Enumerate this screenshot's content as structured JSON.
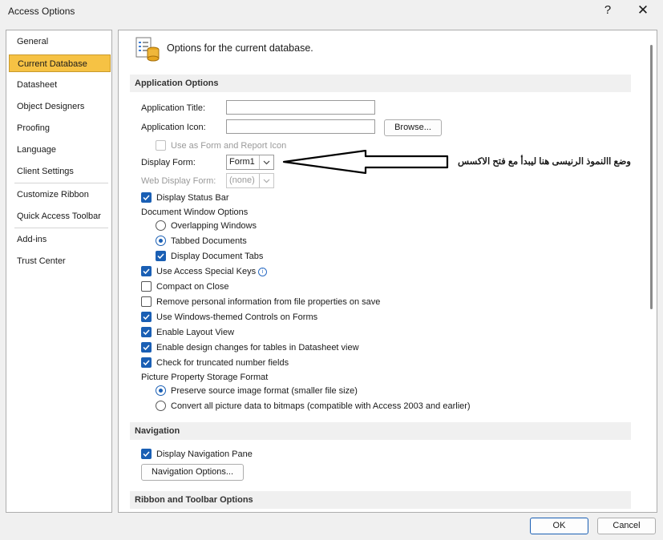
{
  "window": {
    "title": "Access Options",
    "help_glyph": "?",
    "close_glyph": "✕"
  },
  "sidebar": {
    "items": [
      {
        "label": "General"
      },
      {
        "label": "Current Database",
        "active": true
      },
      {
        "label": "Datasheet"
      },
      {
        "label": "Object Designers"
      },
      {
        "label": "Proofing"
      },
      {
        "label": "Language"
      },
      {
        "label": "Client Settings"
      },
      {
        "label": "Customize Ribbon"
      },
      {
        "label": "Quick Access Toolbar"
      },
      {
        "label": "Add-ins"
      },
      {
        "label": "Trust Center"
      }
    ]
  },
  "header": {
    "text": "Options for the current database."
  },
  "app_options": {
    "section_title": "Application Options",
    "app_title_label": "Application Title:",
    "app_title_value": "",
    "app_icon_label": "Application Icon:",
    "app_icon_value": "",
    "browse_label": "Browse...",
    "use_as_form_icon": "Use as Form and Report Icon",
    "display_form_label": "Display Form:",
    "display_form_value": "Form1",
    "web_display_form_label": "Web Display Form:",
    "web_display_form_value": "(none)",
    "display_status_bar": "Display Status Bar",
    "doc_window_options": "Document Window Options",
    "overlapping_windows": "Overlapping Windows",
    "tabbed_documents": "Tabbed Documents",
    "display_document_tabs": "Display Document Tabs",
    "use_access_special_keys": "Use Access Special Keys",
    "info_glyph": "i",
    "compact_on_close": "Compact on Close",
    "remove_personal_info": "Remove personal information from file properties on save",
    "use_windows_themed": "Use Windows-themed Controls on Forms",
    "enable_layout_view": "Enable Layout View",
    "enable_design_changes": "Enable design changes for tables in Datasheet view",
    "check_truncated": "Check for truncated number fields",
    "picture_storage_format": "Picture Property Storage Format",
    "preserve_source": "Preserve source image format (smaller file size)",
    "convert_all": "Convert all picture data to bitmaps (compatible with Access 2003 and earlier)"
  },
  "navigation": {
    "section_title": "Navigation",
    "display_nav_pane": "Display Navigation Pane",
    "nav_options_button": "Navigation Options..."
  },
  "ribbon": {
    "section_title": "Ribbon and Toolbar Options"
  },
  "annotation": {
    "text": "وضع االنموذ الرنيسى هنا ليبدأ مع فتح الاكسس"
  },
  "footer": {
    "ok_label": "OK",
    "cancel_label": "Cancel"
  },
  "colors": {
    "accent": "#1a5fb4",
    "sidebar_active": "#f6c244"
  }
}
